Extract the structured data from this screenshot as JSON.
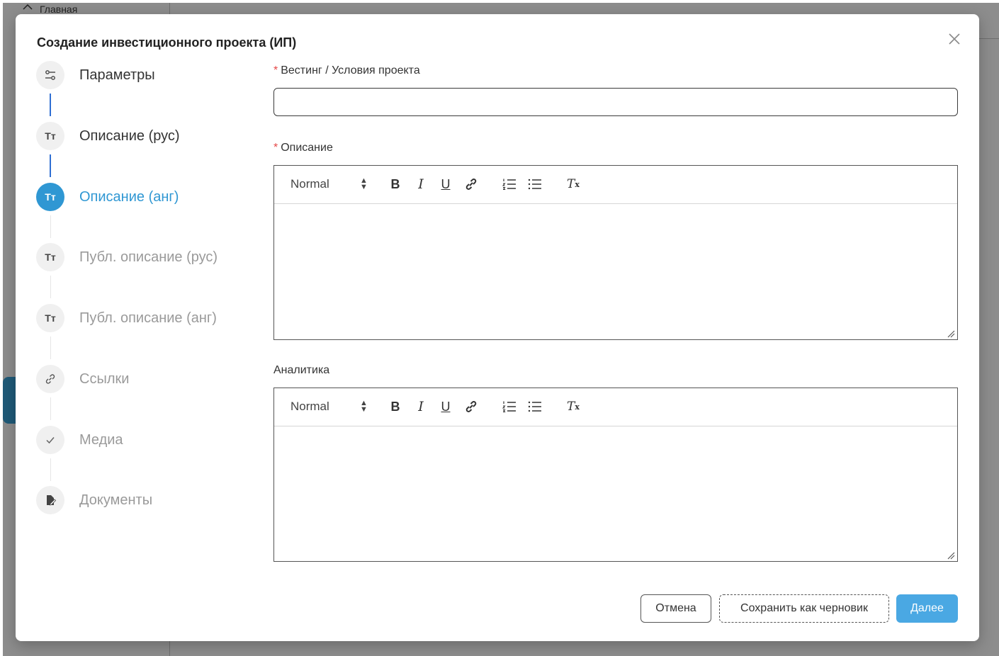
{
  "background": {
    "home_label": "Главная"
  },
  "modal": {
    "title": "Создание инвестиционного проекта (ИП)",
    "close_icon": "close-icon"
  },
  "steps": [
    {
      "label": "Параметры",
      "icon": "sliders-icon",
      "state": "done"
    },
    {
      "label": "Описание (рус)",
      "icon": "text-icon",
      "state": "done"
    },
    {
      "label": "Описание (анг)",
      "icon": "text-icon",
      "state": "active"
    },
    {
      "label": "Публ. описание (рус)",
      "icon": "text-icon",
      "state": "pending"
    },
    {
      "label": "Публ. описание (анг)",
      "icon": "text-icon",
      "state": "pending"
    },
    {
      "label": "Ссылки",
      "icon": "link-icon",
      "state": "pending"
    },
    {
      "label": "Медиа",
      "icon": "check-icon",
      "state": "pending"
    },
    {
      "label": "Документы",
      "icon": "document-icon",
      "state": "pending"
    }
  ],
  "step_icon_text": "Тт",
  "form": {
    "required_mark": "*",
    "vesting": {
      "label": "Вестинг / Условия проекта",
      "value": "",
      "required": true
    },
    "description": {
      "label": "Описание",
      "required": true
    },
    "analytics": {
      "label": "Аналитика",
      "required": false
    },
    "toolbar": {
      "format_value": "Normal",
      "bold": "B",
      "italic": "I",
      "underline": "U",
      "clean": "T",
      "clean_sub": "x"
    }
  },
  "buttons": {
    "cancel": "Отмена",
    "save_draft": "Сохранить как черновик",
    "next": "Далее"
  },
  "colors": {
    "accent": "#2f97d3",
    "primary_button": "#4aa8e3",
    "required": "#e54848",
    "done_connector": "#2f6fd3"
  }
}
